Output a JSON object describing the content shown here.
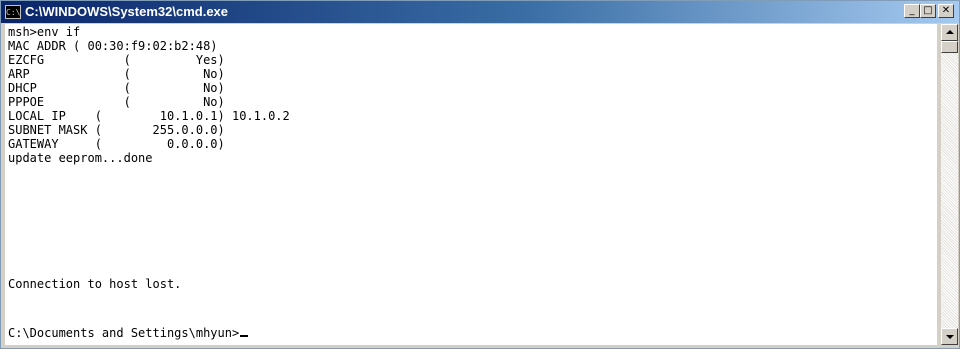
{
  "window": {
    "icon_text": "C:\\",
    "title": "C:\\WINDOWS\\System32\\cmd.exe",
    "minimize_label": "_",
    "maximize_label": "□",
    "close_label": "✕"
  },
  "terminal": {
    "lines": [
      "msh>env if",
      "MAC ADDR ( 00:30:f9:02:b2:48)",
      "EZCFG           (         Yes)",
      "ARP             (          No)",
      "DHCP            (          No)",
      "PPPOE           (          No)",
      "LOCAL IP    (        10.1.0.1) 10.1.0.2",
      "SUBNET MASK (       255.0.0.0)",
      "GATEWAY     (         0.0.0.0)",
      "update eeprom...done",
      "",
      "",
      "Connection to host lost.",
      "",
      "C:\\Documents and Settings\\mhyun>"
    ]
  },
  "icons": {
    "app": "cmd-icon",
    "scroll_up": "arrow-up-icon",
    "scroll_down": "arrow-down-icon"
  },
  "colors": {
    "title_start": "#0a246a",
    "title_end": "#a6caf0",
    "terminal_bg": "#ffffff",
    "terminal_fg": "#000000"
  }
}
